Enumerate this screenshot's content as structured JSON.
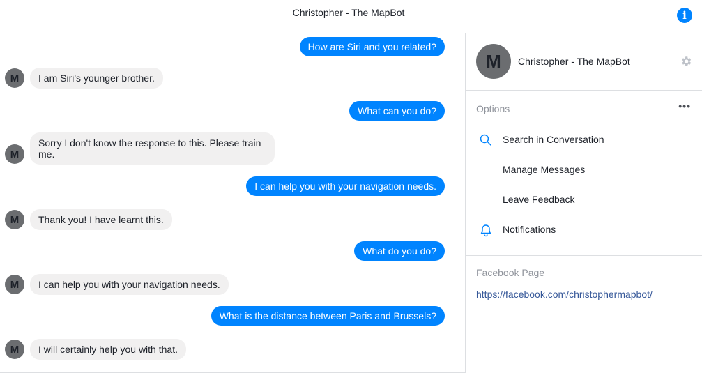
{
  "header": {
    "title": "Christopher - The MapBot"
  },
  "messages": [
    {
      "from": "user",
      "text": "How are Siri and you related?"
    },
    {
      "from": "bot",
      "avatar": "M",
      "text": "I am Siri's younger brother."
    },
    {
      "from": "user",
      "text": "What can you do?"
    },
    {
      "from": "bot",
      "avatar": "M",
      "text": "Sorry I don't know the response to this. Please train me."
    },
    {
      "from": "user",
      "text": "I can help you with your navigation needs."
    },
    {
      "from": "bot",
      "avatar": "M",
      "text": "Thank you! I have learnt this."
    },
    {
      "from": "user",
      "text": "What do you do?"
    },
    {
      "from": "bot",
      "avatar": "M",
      "text": "I can help you with your navigation needs."
    },
    {
      "from": "user",
      "text": "What is the distance between Paris and Brussels?"
    },
    {
      "from": "bot",
      "avatar": "M",
      "text": "I will certainly help you with that."
    }
  ],
  "sidebar": {
    "avatar_letter": "M",
    "name": "Christopher - The MapBot",
    "options_heading": "Options",
    "more": "•••",
    "options": [
      {
        "label": "Search in Conversation",
        "icon": "search-icon"
      },
      {
        "label": "Manage Messages",
        "icon": ""
      },
      {
        "label": "Leave Feedback",
        "icon": ""
      },
      {
        "label": "Notifications",
        "icon": "bell-icon"
      }
    ],
    "facebook_heading": "Facebook Page",
    "facebook_link": "https://facebook.com/christophermapbot/"
  },
  "colors": {
    "accent": "#0084ff",
    "bubble_in": "#f1f0f0",
    "link": "#365899",
    "muted": "#90949c"
  }
}
